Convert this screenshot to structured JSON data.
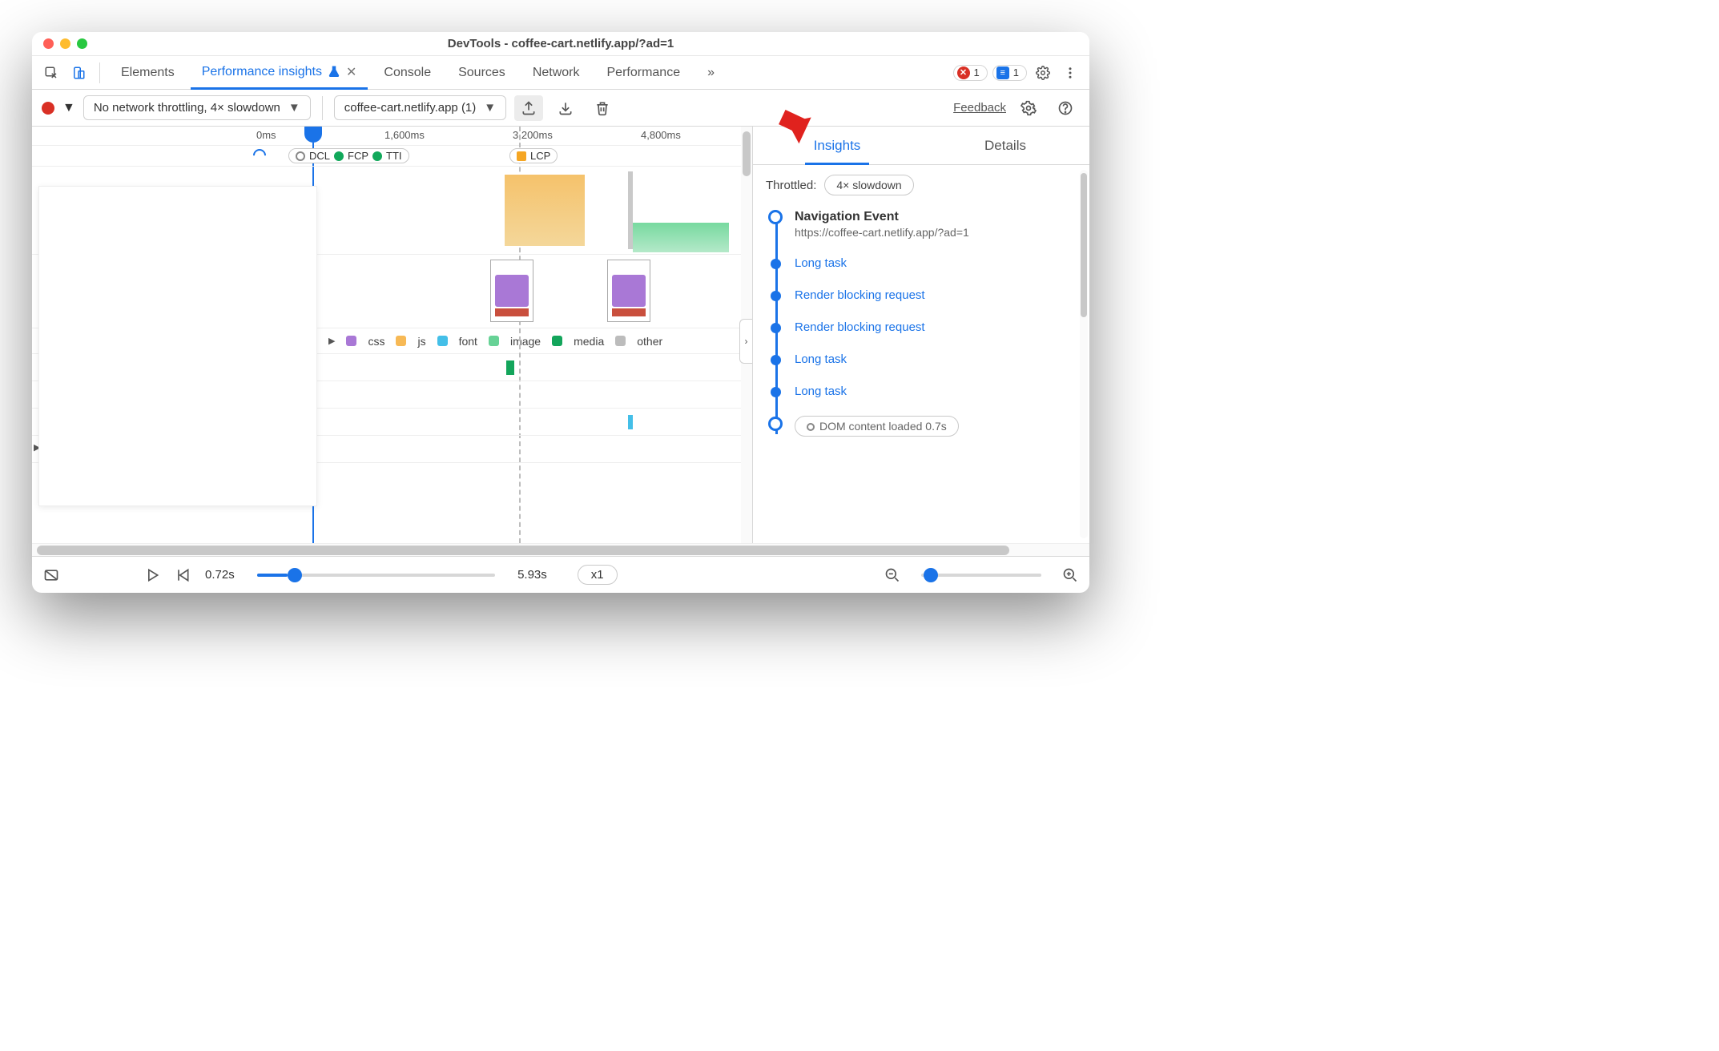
{
  "titlebar": {
    "title": "DevTools - coffee-cart.netlify.app/?ad=1"
  },
  "tabs": {
    "items": [
      "Elements",
      "Performance insights",
      "Console",
      "Sources",
      "Network",
      "Performance"
    ],
    "active_index": 1,
    "more_glyph": "»",
    "error_count": "1",
    "message_count": "1"
  },
  "toolbar": {
    "throttle_select": "No network throttling, 4× slowdown",
    "session_select": "coffee-cart.netlify.app (1)",
    "feedback": "Feedback"
  },
  "ruler": {
    "t0": "0ms",
    "t1": "1,600ms",
    "t2": "3,200ms",
    "t3": "4,800ms"
  },
  "markers": {
    "dcl": "DCL",
    "fcp": "FCP",
    "tti": "TTI",
    "lcp": "LCP"
  },
  "legend": {
    "css": "css",
    "js": "js",
    "font": "font",
    "image": "image",
    "media": "media",
    "other": "other"
  },
  "right": {
    "tabs": {
      "insights": "Insights",
      "details": "Details"
    },
    "throttled_label": "Throttled:",
    "throttled_value": "4× slowdown",
    "nav": {
      "title": "Navigation Event",
      "url": "https://coffee-cart.netlify.app/?ad=1"
    },
    "items": [
      "Long task",
      "Render blocking request",
      "Render blocking request",
      "Long task",
      "Long task"
    ],
    "dcl_item": "DOM content loaded 0.7s"
  },
  "footer": {
    "start_time": "0.72s",
    "end_time": "5.93s",
    "speed": "x1"
  }
}
